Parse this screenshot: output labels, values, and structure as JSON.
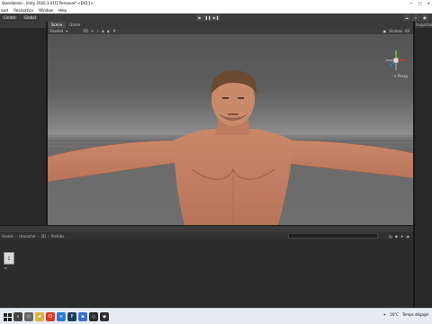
{
  "window": {
    "title": "Standalone - Unity 2020.3.41f1 Personal* <DX11>",
    "controls": [
      "—",
      "□",
      "✕"
    ]
  },
  "menu": [
    "sset",
    "Realisation",
    "Window",
    "Help"
  ],
  "toolbar": {
    "center_label": "Center",
    "global_label": "Global",
    "play_buttons": [
      "▶",
      "❚❚",
      "▶❚"
    ]
  },
  "scene": {
    "tabs": [
      "Scene",
      "Game"
    ],
    "shading_mode": "Shaded",
    "mode_2d": "2D",
    "gizmos_label": "Gizmos",
    "search_placeholder": "All",
    "persp_label": "< Persp"
  },
  "inspector": {
    "title": "Inspector"
  },
  "project": {
    "breadcrumb": [
      "Assets",
      "character",
      "3D",
      "Prefabs"
    ],
    "asset_label": "1",
    "asset_caption": "3D"
  },
  "taskbar": {
    "weather": "16°C",
    "weather_desc": "Temps dégagé"
  },
  "colors": {
    "editor_bg": "#282828",
    "viewport_sky": "#545454",
    "skin": "#c98a6c",
    "hair": "#6b4a30",
    "gizmo_x": "#d6323a",
    "gizmo_y": "#7fbf33",
    "gizmo_z": "#3a77d6"
  }
}
